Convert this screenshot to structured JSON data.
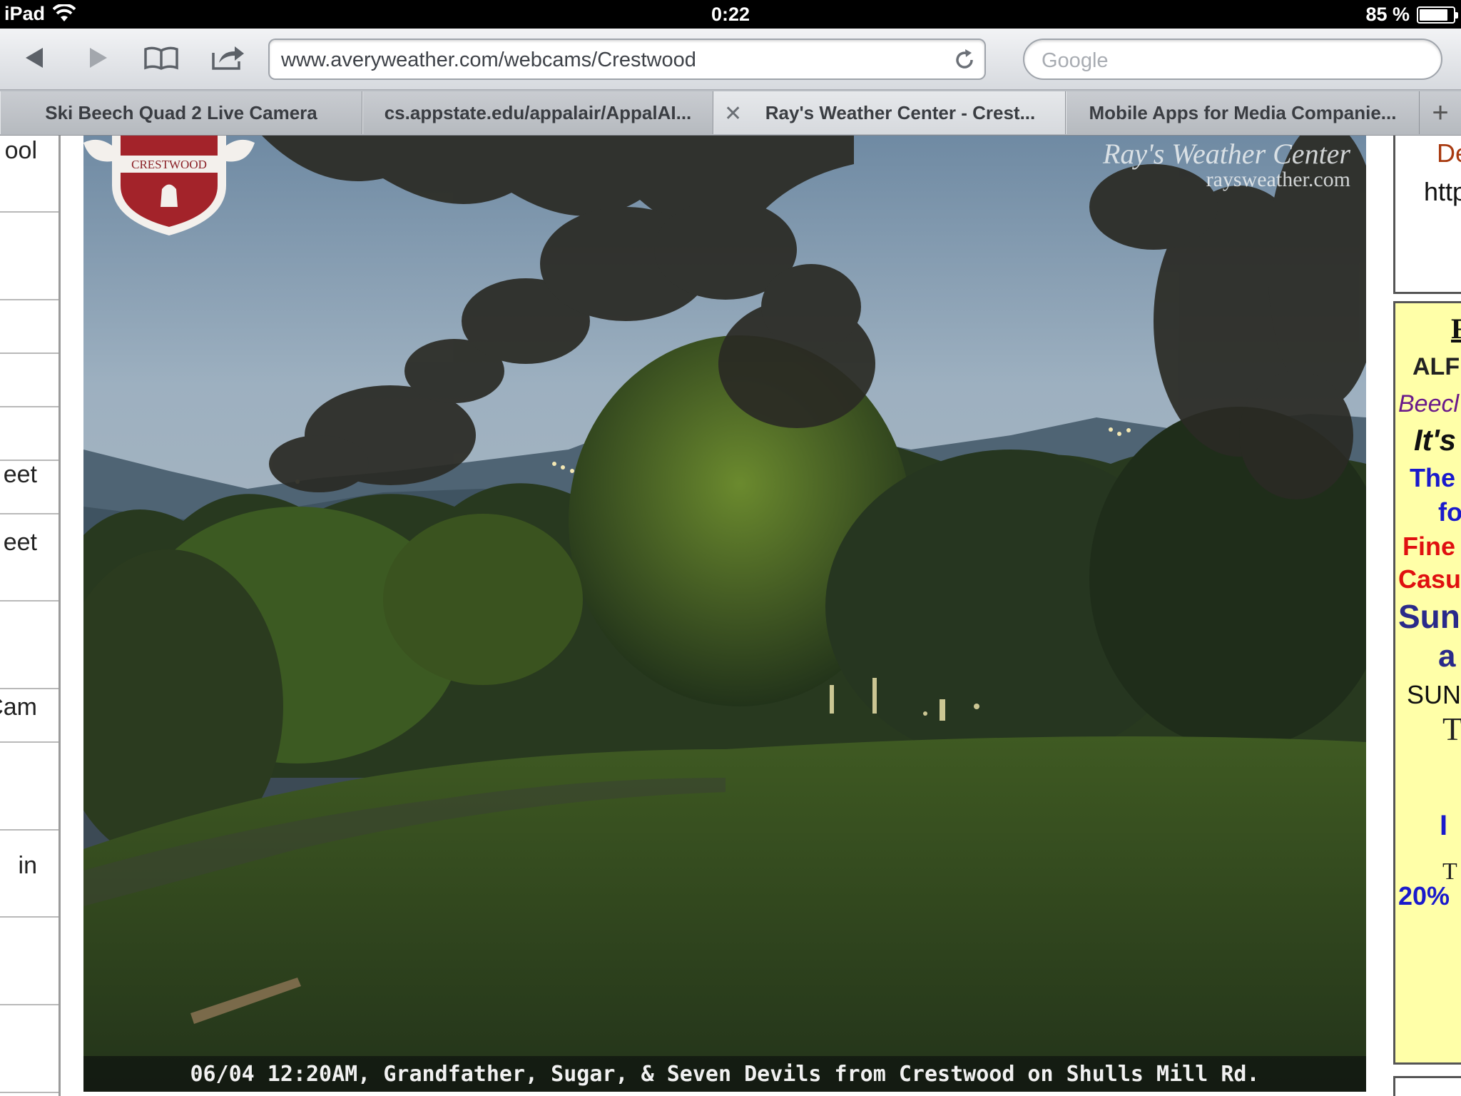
{
  "status_bar": {
    "device": "iPad",
    "time": "0:22",
    "battery_text": "85 %",
    "battery_level": 0.85
  },
  "toolbar": {
    "back_icon": "back-arrow-icon",
    "forward_icon": "forward-arrow-icon",
    "bookmarks_icon": "bookmarks-book-icon",
    "share_icon": "share-icon",
    "url": "www.averyweather.com/webcams/Crestwood",
    "search_placeholder": "Google"
  },
  "tabs": [
    {
      "label": "Ski Beech Quad 2 Live Camera",
      "active": false
    },
    {
      "label": "cs.appstate.edu/appalair/AppalAI...",
      "active": false
    },
    {
      "label": "Ray's Weather Center - Crest...",
      "active": true
    },
    {
      "label": "Mobile Apps for Media Companie...",
      "active": false
    }
  ],
  "new_tab": "+",
  "left_nav": [
    "ool",
    "",
    "",
    "",
    "",
    "eet",
    "",
    "Cam",
    "",
    "in",
    "",
    ""
  ],
  "webcam": {
    "caption": "06/04 12:20AM, Grandfather, Sugar, & Seven Devils from Crestwood on Shulls Mill Rd.",
    "brand_line1": "Ray's Weather Center",
    "brand_line2": "raysweather.com",
    "crest_text": "CRESTWOOD"
  },
  "right_column": {
    "box1": {
      "line1": "De",
      "line2": "http"
    },
    "box2": {
      "lines": [
        "F",
        "ALF",
        "Beecl",
        "It's",
        "The",
        "fo",
        "Fine",
        "Casu",
        "Sun",
        "a",
        "SUN",
        "T",
        "I",
        "T",
        "20%"
      ]
    }
  },
  "colors": {
    "status_bar": "#000000",
    "toolbar": "#e3e5e8",
    "tab_bar": "#b9bdc3",
    "ad_background": "#ffffa8",
    "ad_blue": "#1a1acc",
    "ad_red": "#e01010",
    "ad_purple": "#6a1a8a"
  }
}
